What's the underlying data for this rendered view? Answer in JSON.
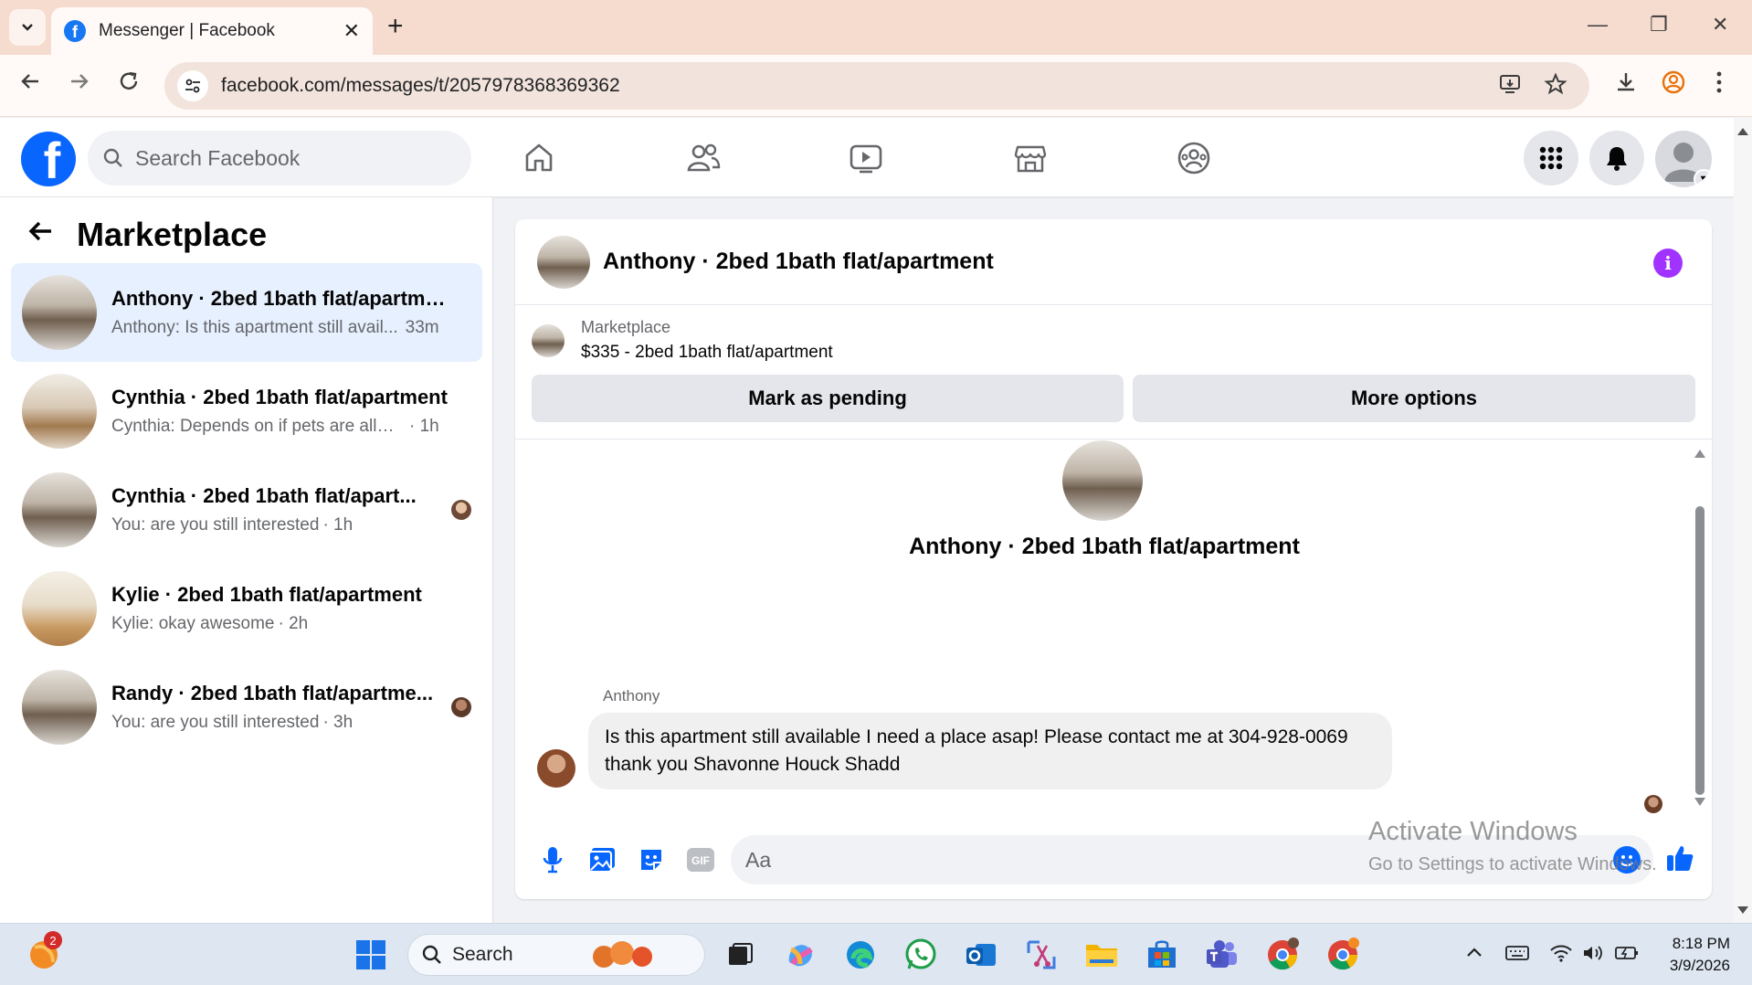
{
  "browser": {
    "tab_title": "Messenger | Facebook",
    "url": "facebook.com/messages/t/2057978368369362"
  },
  "facebook": {
    "search_placeholder": "Search Facebook"
  },
  "sidebar": {
    "title": "Marketplace",
    "conversations": [
      {
        "name": "Anthony · 2bed 1bath flat/apartme...",
        "snippet": "Anthony: Is this apartment still avail...",
        "time": "33m",
        "active": true
      },
      {
        "name": "Cynthia · 2bed 1bath flat/apartment",
        "snippet": "Cynthia: Depends on if pets are allow...",
        "time": "· 1h"
      },
      {
        "name": "Cynthia · 2bed 1bath flat/apart...",
        "snippet": "You: are you still interested",
        "time": "· 1h"
      },
      {
        "name": "Kylie · 2bed 1bath flat/apartment",
        "snippet": "Kylie: okay awesome",
        "time": "· 2h"
      },
      {
        "name": "Randy · 2bed 1bath flat/apartme...",
        "snippet": "You: are you still interested",
        "time": "· 3h"
      }
    ]
  },
  "chat": {
    "header_name": "Anthony · 2bed 1bath flat/apartment",
    "listing_label": "Marketplace",
    "listing_title": "$335 - 2bed 1bath flat/apartment",
    "mark_pending_label": "Mark as pending",
    "more_options_label": "More options",
    "conversation_name": "Anthony · 2bed 1bath flat/apartment",
    "sender": "Anthony",
    "message": "Is this apartment still available I need a place asap! Please contact me at 304-928-0069 thank you Shavonne Houck Shadd",
    "composer_placeholder": "Aa"
  },
  "watermark": {
    "line1": "Activate Windows",
    "line2": "Go to Settings to activate Windows."
  },
  "taskbar": {
    "search_placeholder": "Search",
    "notification_count": "2",
    "time": "8:18 PM",
    "date": "3/9/2026"
  },
  "colors": {
    "facebook_blue": "#0866ff",
    "active_conversation": "#e7f0fe",
    "info_purple": "#a033ff"
  }
}
